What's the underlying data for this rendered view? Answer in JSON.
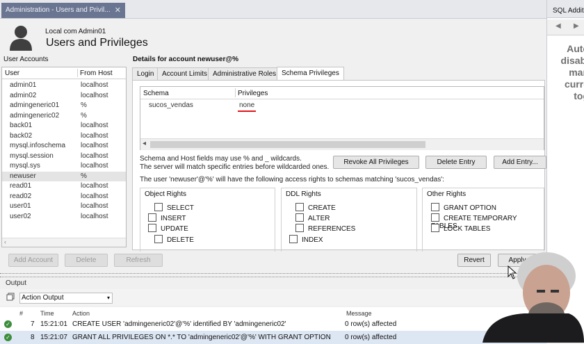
{
  "tabs": {
    "document_tab": "Administration - Users and Privil..."
  },
  "sql_panel": {
    "title": "SQL Additi",
    "text": "Auto\ndisabl\nman\ncurre\ntog"
  },
  "header": {
    "connection": "Local com Admin01",
    "title": "Users and Privileges"
  },
  "user_accounts": {
    "title": "User Accounts",
    "col_user": "User",
    "col_host": "From Host",
    "rows": [
      {
        "user": "admin01",
        "host": "localhost"
      },
      {
        "user": "admin02",
        "host": "localhost"
      },
      {
        "user": "admingeneric01",
        "host": "%"
      },
      {
        "user": "admingeneric02",
        "host": "%"
      },
      {
        "user": "back01",
        "host": "localhost"
      },
      {
        "user": "back02",
        "host": "localhost"
      },
      {
        "user": "mysql.infoschema",
        "host": "localhost"
      },
      {
        "user": "mysql.session",
        "host": "localhost"
      },
      {
        "user": "mysql.sys",
        "host": "localhost"
      },
      {
        "user": "newuser",
        "host": "%"
      },
      {
        "user": "read01",
        "host": "localhost"
      },
      {
        "user": "read02",
        "host": "localhost"
      },
      {
        "user": "user01",
        "host": "localhost"
      },
      {
        "user": "user02",
        "host": "localhost"
      }
    ],
    "selected_index": 9
  },
  "details": {
    "title": "Details for account newuser@%",
    "tabs": [
      "Login",
      "Account Limits",
      "Administrative Roles",
      "Schema Privileges"
    ],
    "active_tab": 3,
    "schema_table": {
      "col_schema": "Schema",
      "col_privileges": "Privileges",
      "rows": [
        {
          "schema": "sucos_vendas",
          "privileges": "none"
        }
      ]
    },
    "hint_line1": "Schema and Host fields may use % and _ wildcards.",
    "hint_line2": "The server will match specific entries before wildcarded ones.",
    "buttons": {
      "revoke_all": "Revoke All Privileges",
      "delete_entry": "Delete Entry",
      "add_entry": "Add Entry..."
    },
    "access_line": "The user 'newuser'@'%' will have the following access rights to schemas matching 'sucos_vendas':",
    "object_rights": {
      "title": "Object Rights",
      "items": [
        "SELECT",
        "INSERT",
        "UPDATE",
        "DELETE"
      ]
    },
    "ddl_rights": {
      "title": "DDL Rights",
      "items": [
        "CREATE",
        "ALTER",
        "REFERENCES",
        "INDEX"
      ]
    },
    "other_rights": {
      "title": "Other Rights",
      "items": [
        "GRANT OPTION",
        "CREATE TEMPORARY TABLES",
        "LOCK TABLES"
      ]
    }
  },
  "bottom_buttons": {
    "add_account": "Add Account",
    "delete": "Delete",
    "refresh": "Refresh",
    "revert": "Revert",
    "apply": "Apply"
  },
  "output": {
    "label": "Output",
    "selector": "Action Output",
    "col_num": "#",
    "col_time": "Time",
    "col_action": "Action",
    "col_message": "Message",
    "rows": [
      {
        "num": "7",
        "time": "15:21:01",
        "action": "CREATE USER 'admingeneric02'@'%' identified BY 'admingeneric02'",
        "message": "0 row(s) affected"
      },
      {
        "num": "8",
        "time": "15:21:07",
        "action": "GRANT ALL PRIVILEGES ON *.* TO 'admingeneric02'@'%' WITH GRANT OPTION",
        "message": "0 row(s) affected"
      }
    ]
  },
  "colors": {
    "tab_active": "#6a7591",
    "underline": "#e0151b",
    "status_ok": "#3c8e3c"
  }
}
